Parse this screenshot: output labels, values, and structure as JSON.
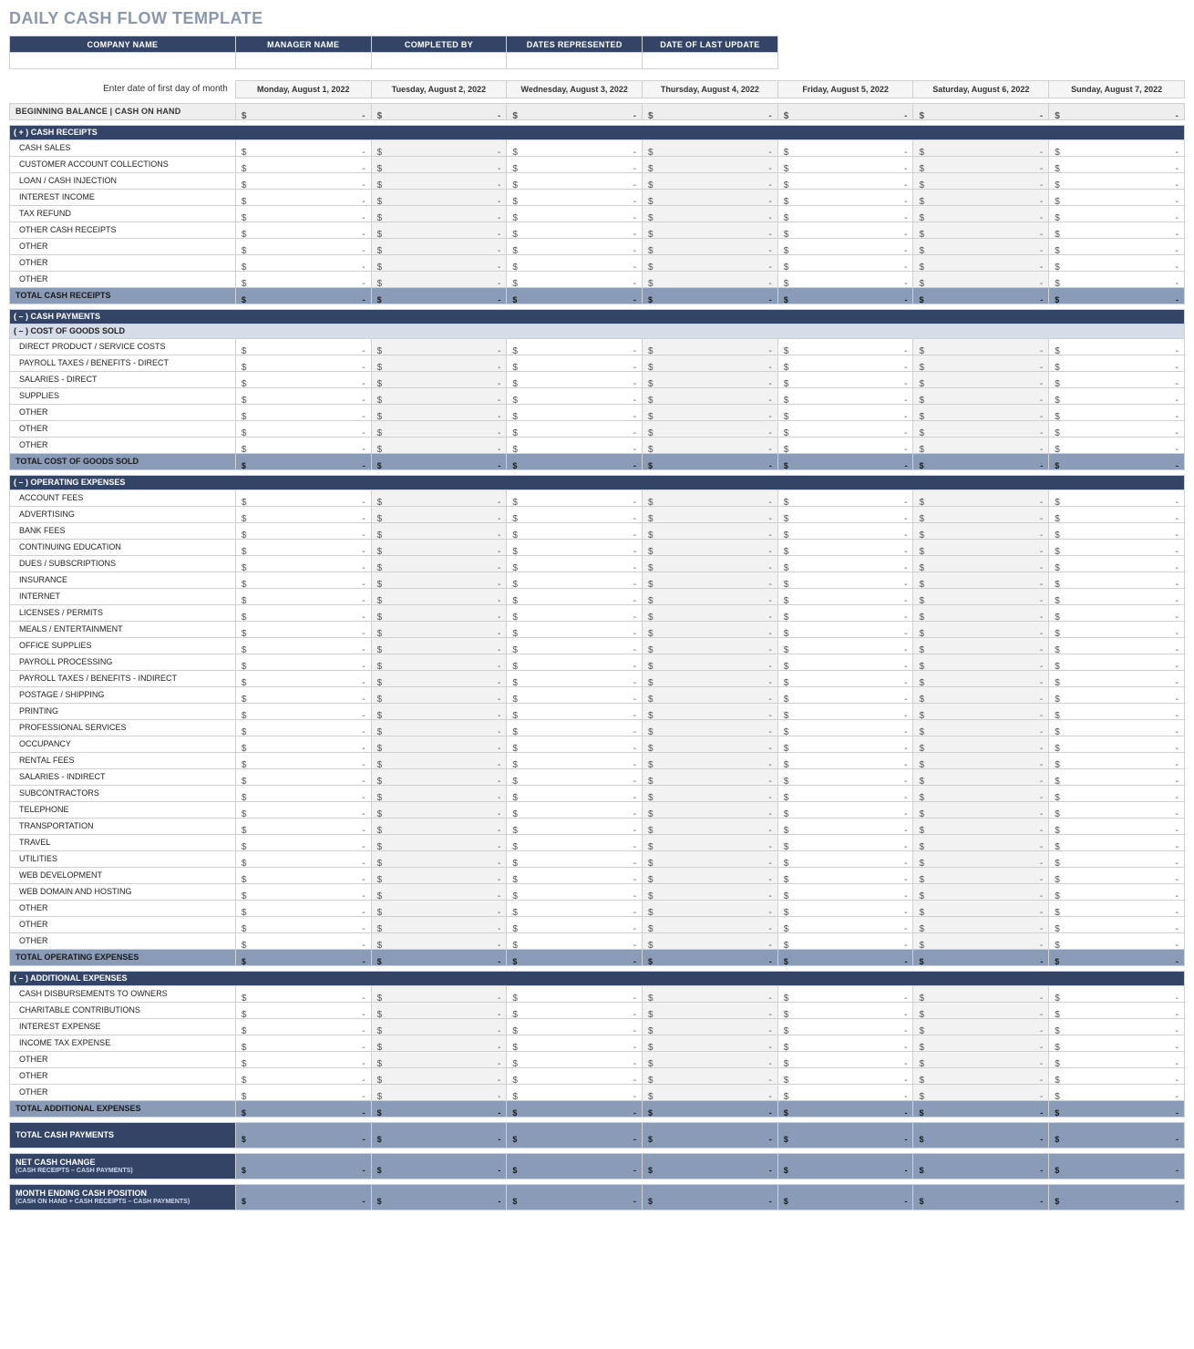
{
  "title": "DAILY CASH FLOW TEMPLATE",
  "info_headers": [
    "COMPANY NAME",
    "MANAGER NAME",
    "COMPLETED BY",
    "DATES REPRESENTED",
    "DATE OF LAST UPDATE"
  ],
  "info_values": [
    "",
    "",
    "",
    "",
    ""
  ],
  "date_prompt": "Enter date of first day of month",
  "dates": [
    "Monday, August 1, 2022",
    "Tuesday, August 2, 2022",
    "Wednesday, August 3, 2022",
    "Thursday, August 4, 2022",
    "Friday, August 5, 2022",
    "Saturday, August 6, 2022",
    "Sunday, August 7, 2022"
  ],
  "beginning_balance_label": "BEGINNING BALANCE  |  CASH ON HAND",
  "sections": {
    "receipts_header": "( + )  CASH RECEIPTS",
    "receipts_rows": [
      "CASH SALES",
      "CUSTOMER ACCOUNT COLLECTIONS",
      "LOAN / CASH INJECTION",
      "INTEREST INCOME",
      "TAX REFUND",
      "OTHER CASH RECEIPTS",
      "OTHER",
      "OTHER",
      "OTHER"
    ],
    "receipts_total": "TOTAL CASH RECEIPTS",
    "payments_header": "( – )  CASH PAYMENTS",
    "cogs_header": "( – )  COST OF GOODS SOLD",
    "cogs_rows": [
      "DIRECT PRODUCT / SERVICE COSTS",
      "PAYROLL TAXES / BENEFITS - DIRECT",
      "SALARIES - DIRECT",
      "SUPPLIES",
      "OTHER",
      "OTHER",
      "OTHER"
    ],
    "cogs_total": "TOTAL COST OF GOODS SOLD",
    "opex_header": "( – )  OPERATING EXPENSES",
    "opex_rows": [
      "ACCOUNT FEES",
      "ADVERTISING",
      "BANK FEES",
      "CONTINUING EDUCATION",
      "DUES / SUBSCRIPTIONS",
      "INSURANCE",
      "INTERNET",
      "LICENSES / PERMITS",
      "MEALS / ENTERTAINMENT",
      "OFFICE SUPPLIES",
      "PAYROLL PROCESSING",
      "PAYROLL TAXES / BENEFITS - INDIRECT",
      "POSTAGE / SHIPPING",
      "PRINTING",
      "PROFESSIONAL SERVICES",
      "OCCUPANCY",
      "RENTAL FEES",
      "SALARIES - INDIRECT",
      "SUBCONTRACTORS",
      "TELEPHONE",
      "TRANSPORTATION",
      "TRAVEL",
      "UTILITIES",
      "WEB DEVELOPMENT",
      "WEB DOMAIN AND HOSTING",
      "OTHER",
      "OTHER",
      "OTHER"
    ],
    "opex_total": "TOTAL OPERATING EXPENSES",
    "addl_header": "( – )  ADDITIONAL EXPENSES",
    "addl_rows": [
      "CASH DISBURSEMENTS TO OWNERS",
      "CHARITABLE CONTRIBUTIONS",
      "INTEREST EXPENSE",
      "INCOME TAX EXPENSE",
      "OTHER",
      "OTHER",
      "OTHER"
    ],
    "addl_total": "TOTAL ADDITIONAL EXPENSES",
    "total_payments": "TOTAL CASH PAYMENTS",
    "net_change": "NET CASH CHANGE",
    "net_change_sub": "(CASH RECEIPTS – CASH PAYMENTS)",
    "ending": "MONTH ENDING CASH POSITION",
    "ending_sub": "(CASH ON HAND + CASH RECEIPTS – CASH PAYMENTS)"
  },
  "money_placeholder": {
    "dollar": "$",
    "dash": "-"
  }
}
